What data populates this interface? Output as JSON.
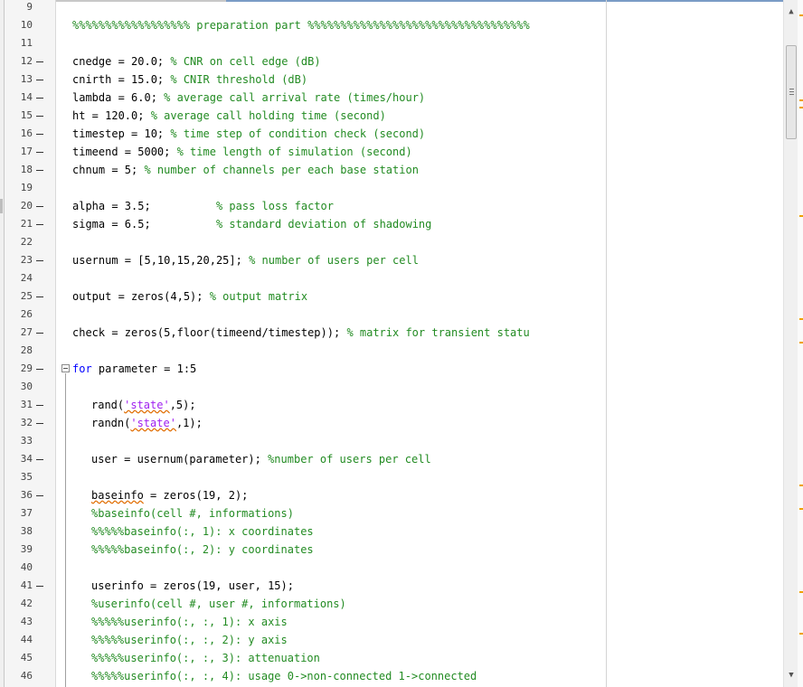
{
  "editor": {
    "visible_lines": [
      {
        "num": "9",
        "exec": false,
        "parts": []
      },
      {
        "num": "10",
        "exec": false,
        "parts": [
          {
            "c": "cmt",
            "t": "%%%%%%%%%%%%%%%%%% preparation part %%%%%%%%%%%%%%%%%%%%%%%%%%%%%%%%%%"
          }
        ]
      },
      {
        "num": "11",
        "exec": false,
        "parts": []
      },
      {
        "num": "12",
        "exec": true,
        "parts": [
          {
            "t": "cnedge = 20.0; "
          },
          {
            "c": "cmt",
            "t": "% CNR on cell edge (dB)"
          }
        ]
      },
      {
        "num": "13",
        "exec": true,
        "parts": [
          {
            "t": "cnirth = 15.0; "
          },
          {
            "c": "cmt",
            "t": "% CNIR threshold (dB)"
          }
        ]
      },
      {
        "num": "14",
        "exec": true,
        "parts": [
          {
            "t": "lambda = 6.0; "
          },
          {
            "c": "cmt",
            "t": "% average call arrival rate (times/hour)"
          }
        ]
      },
      {
        "num": "15",
        "exec": true,
        "parts": [
          {
            "t": "ht = 120.0; "
          },
          {
            "c": "cmt",
            "t": "% average call holding time (second)"
          }
        ]
      },
      {
        "num": "16",
        "exec": true,
        "parts": [
          {
            "t": "timestep = 10; "
          },
          {
            "c": "cmt",
            "t": "% time step of condition check (second)"
          }
        ]
      },
      {
        "num": "17",
        "exec": true,
        "parts": [
          {
            "t": "timeend = 5000; "
          },
          {
            "c": "cmt",
            "t": "% time length of simulation (second)"
          }
        ]
      },
      {
        "num": "18",
        "exec": true,
        "parts": [
          {
            "t": "chnum = 5; "
          },
          {
            "c": "cmt",
            "t": "% number of channels per each base station"
          }
        ]
      },
      {
        "num": "19",
        "exec": false,
        "parts": []
      },
      {
        "num": "20",
        "exec": true,
        "parts": [
          {
            "t": "alpha = 3.5;          "
          },
          {
            "c": "cmt",
            "t": "% pass loss factor"
          }
        ]
      },
      {
        "num": "21",
        "exec": true,
        "parts": [
          {
            "t": "sigma = 6.5;          "
          },
          {
            "c": "cmt",
            "t": "% standard deviation of shadowing"
          }
        ]
      },
      {
        "num": "22",
        "exec": false,
        "parts": []
      },
      {
        "num": "23",
        "exec": true,
        "parts": [
          {
            "t": "usernum = [5,10,15,20,25]; "
          },
          {
            "c": "cmt",
            "t": "% number of users per cell"
          }
        ]
      },
      {
        "num": "24",
        "exec": false,
        "parts": []
      },
      {
        "num": "25",
        "exec": true,
        "parts": [
          {
            "t": "output = zeros(4,5); "
          },
          {
            "c": "cmt",
            "t": "% output matrix"
          }
        ]
      },
      {
        "num": "26",
        "exec": false,
        "parts": []
      },
      {
        "num": "27",
        "exec": true,
        "parts": [
          {
            "t": "check = zeros(5,floor(timeend/timestep)); "
          },
          {
            "c": "cmt",
            "t": "% matrix for transient statu"
          }
        ]
      },
      {
        "num": "28",
        "exec": false,
        "parts": []
      },
      {
        "num": "29",
        "exec": true,
        "parts": [
          {
            "c": "kw",
            "t": "for"
          },
          {
            "t": " parameter = 1:5"
          }
        ]
      },
      {
        "num": "30",
        "exec": false,
        "parts": []
      },
      {
        "num": "31",
        "exec": true,
        "ind": 2,
        "parts": [
          {
            "t": "rand("
          },
          {
            "c": "str sq",
            "t": "'state'"
          },
          {
            "t": ",5);"
          }
        ]
      },
      {
        "num": "32",
        "exec": true,
        "ind": 2,
        "parts": [
          {
            "t": "randn("
          },
          {
            "c": "str sq",
            "t": "'state'"
          },
          {
            "t": ",1);"
          }
        ]
      },
      {
        "num": "33",
        "exec": false,
        "parts": []
      },
      {
        "num": "34",
        "exec": true,
        "ind": 2,
        "parts": [
          {
            "t": "user = usernum(parameter); "
          },
          {
            "c": "cmt",
            "t": "%number of users per cell"
          }
        ]
      },
      {
        "num": "35",
        "exec": false,
        "parts": []
      },
      {
        "num": "36",
        "exec": true,
        "ind": 2,
        "parts": [
          {
            "c": "sq",
            "t": "baseinfo"
          },
          {
            "t": " = zeros(19, 2);"
          }
        ]
      },
      {
        "num": "37",
        "exec": false,
        "ind": 2,
        "parts": [
          {
            "c": "cmt",
            "t": "%baseinfo(cell #, informations)"
          }
        ]
      },
      {
        "num": "38",
        "exec": false,
        "ind": 2,
        "parts": [
          {
            "c": "cmt",
            "t": "%%%%%baseinfo(:, 1): x coordinates"
          }
        ]
      },
      {
        "num": "39",
        "exec": false,
        "ind": 2,
        "parts": [
          {
            "c": "cmt",
            "t": "%%%%%baseinfo(:, 2): y coordinates"
          }
        ]
      },
      {
        "num": "40",
        "exec": false,
        "parts": []
      },
      {
        "num": "41",
        "exec": true,
        "ind": 2,
        "parts": [
          {
            "t": "userinfo = zeros(19, user, 15);"
          }
        ]
      },
      {
        "num": "42",
        "exec": false,
        "ind": 2,
        "parts": [
          {
            "c": "cmt",
            "t": "%userinfo(cell #, user #, informations)"
          }
        ]
      },
      {
        "num": "43",
        "exec": false,
        "ind": 2,
        "parts": [
          {
            "c": "cmt",
            "t": "%%%%%userinfo(:, :, 1): x axis"
          }
        ]
      },
      {
        "num": "44",
        "exec": false,
        "ind": 2,
        "parts": [
          {
            "c": "cmt",
            "t": "%%%%%userinfo(:, :, 2): y axis"
          }
        ]
      },
      {
        "num": "45",
        "exec": false,
        "ind": 2,
        "parts": [
          {
            "c": "cmt",
            "t": "%%%%%userinfo(:, :, 3): attenuation"
          }
        ]
      },
      {
        "num": "46",
        "exec": false,
        "ind": 2,
        "parts": [
          {
            "c": "cmt",
            "t": "%%%%%userinfo(:, :, 4): usage 0->non-connected 1->connected"
          }
        ]
      }
    ]
  },
  "scrollbar": {
    "up_glyph": "▲",
    "down_glyph": "▼",
    "position_fraction": 0.08
  },
  "colors": {
    "comment": "#228b22",
    "keyword": "#0000ff",
    "string": "#a020f0",
    "marker": "#f0a000",
    "squiggle": "#e06c00"
  },
  "icons": {
    "fold": "fold-collapse-icon",
    "scroll_up": "scroll-up-arrow-icon",
    "scroll_down": "scroll-down-arrow-icon"
  }
}
